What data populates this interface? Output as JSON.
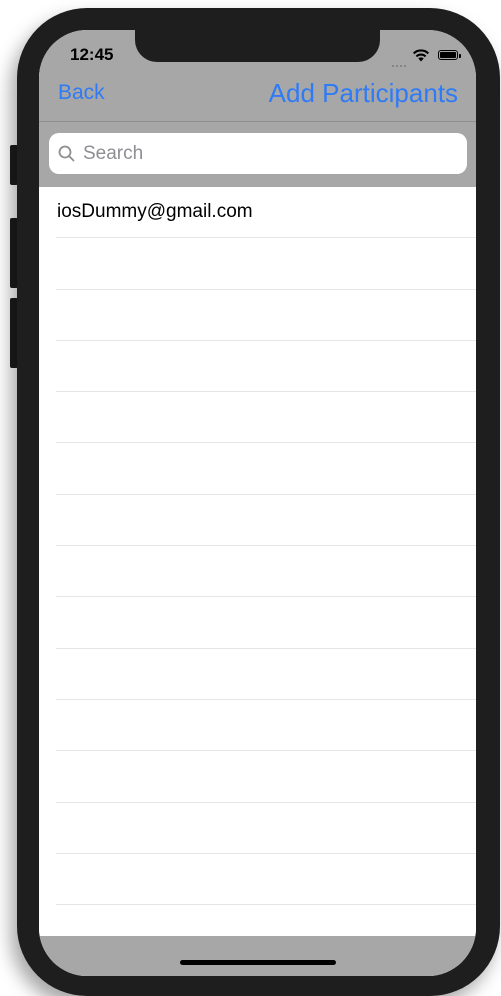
{
  "status_bar": {
    "time": "12:45"
  },
  "nav": {
    "back_label": "Back",
    "add_label": "Add Participants"
  },
  "search": {
    "placeholder": "Search",
    "value": ""
  },
  "participants": [
    "iosDummy@gmail.com"
  ],
  "colors": {
    "accent": "#2f7bf5",
    "bar_background": "#a7a7a7",
    "device_frame": "#1e1e1e"
  },
  "icons": [
    "search-icon",
    "wifi-icon",
    "battery-icon",
    "signal-dots-icon"
  ]
}
